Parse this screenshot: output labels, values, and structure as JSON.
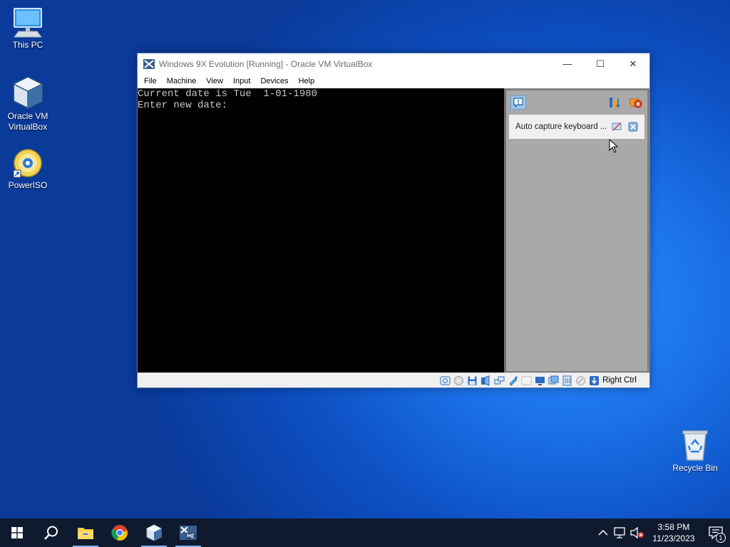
{
  "desktop": {
    "icons": [
      {
        "label": "This PC"
      },
      {
        "label": "Oracle VM VirtualBox"
      },
      {
        "label": "PowerISO"
      },
      {
        "label": "Recycle Bin"
      }
    ]
  },
  "window": {
    "title": "Windows 9X Evolution [Running] - Oracle VM VirtualBox",
    "controls": {
      "minimize": "—",
      "maximize": "☐",
      "close": "✕"
    },
    "menu": [
      "File",
      "Machine",
      "View",
      "Input",
      "Devices",
      "Help"
    ],
    "console": {
      "line1": "Current date is Tue  1-01-1980",
      "line2": "Enter new date:"
    },
    "notification": {
      "text": "Auto capture keyboard ..."
    },
    "status": {
      "host_key": "Right Ctrl"
    }
  },
  "taskbar": {
    "clock_time": "3:58 PM",
    "clock_date": "11/23/2023",
    "notification_count": "1"
  },
  "colors": {
    "taskbar": "#101a2e",
    "vm_side_panel": "#a9a9a9",
    "console_bg": "#000000"
  }
}
